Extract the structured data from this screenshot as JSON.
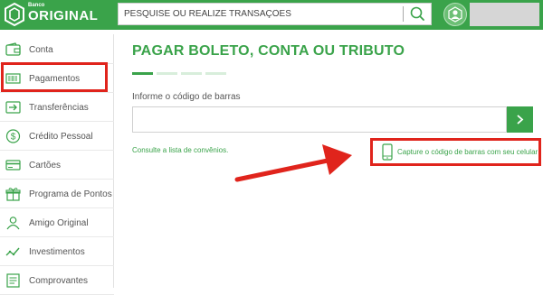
{
  "brand": {
    "small": "Banco",
    "big": "ORIGINAL"
  },
  "search": {
    "placeholder": "PESQUISE OU REALIZE TRANSAÇÕES",
    "value": ""
  },
  "sidebar": {
    "items": [
      {
        "label": "Conta",
        "icon": "wallet-icon"
      },
      {
        "label": "Pagamentos",
        "icon": "barcode-icon"
      },
      {
        "label": "Transferências",
        "icon": "transfer-arrow-icon"
      },
      {
        "label": "Crédito Pessoal",
        "icon": "dollar-coin-icon"
      },
      {
        "label": "Cartões",
        "icon": "card-icon"
      },
      {
        "label": "Programa de Pontos",
        "icon": "gift-icon"
      },
      {
        "label": "Amigo Original",
        "icon": "person-icon"
      },
      {
        "label": "Investimentos",
        "icon": "chart-line-icon"
      },
      {
        "label": "Comprovantes",
        "icon": "receipt-icon"
      }
    ]
  },
  "main": {
    "title": "PAGAR BOLETO, CONTA OU TRIBUTO",
    "steps": {
      "count": 4,
      "active": 1
    },
    "barcode_label": "Informe o código de barras",
    "barcode_value": "",
    "convenios_link": "Consulte a lista de convênios.",
    "capture_link": "Capture o código de barras com seu celular"
  },
  "colors": {
    "brand_green": "#3aa34a",
    "annotation_red": "#e0241c"
  }
}
